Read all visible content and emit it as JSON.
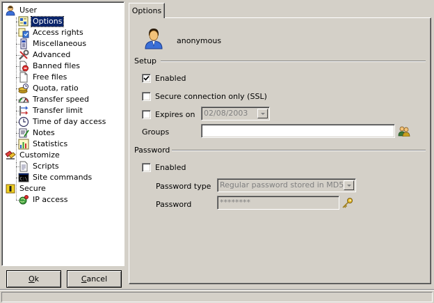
{
  "tree": {
    "user": {
      "label": "User",
      "icon": "user-icon"
    },
    "user_children": [
      {
        "label": "Options",
        "icon": "options-icon",
        "selected": true
      },
      {
        "label": "Access rights",
        "icon": "access-rights-icon"
      },
      {
        "label": "Miscellaneous",
        "icon": "miscellaneous-icon"
      },
      {
        "label": "Advanced",
        "icon": "advanced-tools-icon"
      },
      {
        "label": "Banned files",
        "icon": "banned-files-icon"
      },
      {
        "label": "Free files",
        "icon": "free-files-icon"
      },
      {
        "label": "Quota, ratio",
        "icon": "quota-icon"
      },
      {
        "label": "Transfer speed",
        "icon": "speedometer-icon"
      },
      {
        "label": "Transfer limit",
        "icon": "transfer-limit-icon"
      },
      {
        "label": "Time of day access",
        "icon": "clock-icon"
      },
      {
        "label": "Notes",
        "icon": "notes-icon"
      },
      {
        "label": "Statistics",
        "icon": "statistics-icon"
      }
    ],
    "customize": {
      "label": "Customize",
      "icon": "customize-icon"
    },
    "customize_children": [
      {
        "label": "Scripts",
        "icon": "scripts-icon"
      },
      {
        "label": "Site commands",
        "icon": "console-icon"
      }
    ],
    "secure": {
      "label": "Secure",
      "icon": "secure-icon"
    },
    "secure_children": [
      {
        "label": "IP access",
        "icon": "ip-access-icon"
      }
    ]
  },
  "buttons": {
    "ok": {
      "label": "Ok",
      "accel": "O",
      "rest": "k"
    },
    "cancel": {
      "label": "Cancel",
      "accel": "C",
      "rest": "ancel"
    }
  },
  "tab": {
    "label": "Options"
  },
  "user": {
    "name": "anonymous",
    "icon": "user-avatar-icon"
  },
  "setup": {
    "heading": "Setup",
    "enabled": {
      "label": "Enabled",
      "checked": true
    },
    "secure_only": {
      "label": "Secure connection only (SSL)",
      "checked": false
    },
    "expires": {
      "label": "Expires on",
      "checked": false,
      "date": "02/08/2003"
    },
    "groups": {
      "label": "Groups",
      "value": "",
      "icon": "groups-icon"
    }
  },
  "password": {
    "heading": "Password",
    "enabled": {
      "label": "Enabled",
      "checked": false
    },
    "type": {
      "label": "Password type",
      "value": "Regular password stored in MD5"
    },
    "field": {
      "label": "Password",
      "value": "********",
      "icon": "key-icon"
    }
  },
  "colors": {
    "face": "#d4d0c8",
    "selection": "#0a246a",
    "shadow": "#808080",
    "highlight": "#ffffff"
  }
}
